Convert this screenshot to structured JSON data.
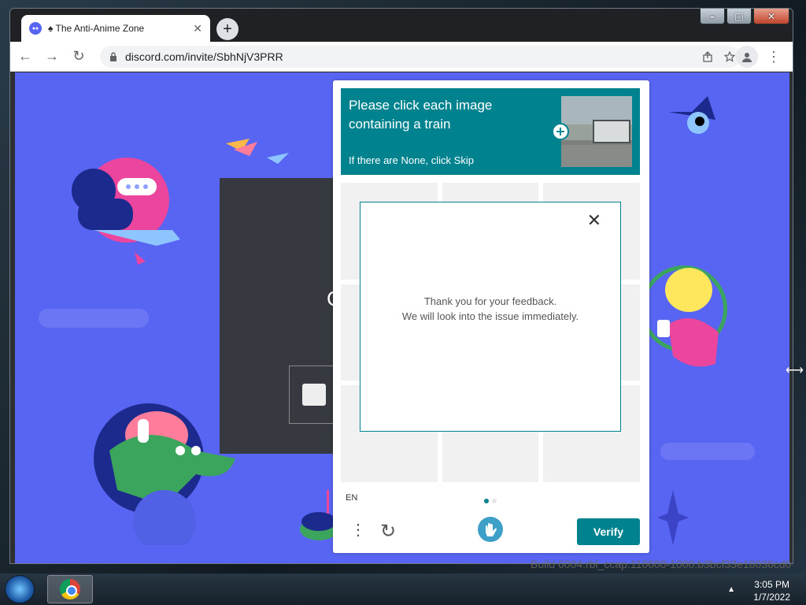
{
  "browser": {
    "tab": {
      "title": "♠ The Anti-Anime Zone",
      "close_symbol": "✕"
    },
    "new_tab_symbol": "+",
    "nav": {
      "back": "←",
      "forward": "→",
      "reload": "↻"
    },
    "address": {
      "url": "discord.com/invite/SbhNjV3PRR"
    },
    "menu_symbol": "⋮",
    "window_controls": {
      "minimize": "–",
      "maximize": "□",
      "close": "✕"
    }
  },
  "invite_card": {
    "partial_letter": "C"
  },
  "captcha": {
    "prompt_line1": "Please click each image",
    "prompt_line2": "containing a train",
    "skip_hint": "If there are None, click Skip",
    "expand_symbol": "+",
    "feedback": {
      "close_symbol": "✕",
      "line1": "Thank you for your feedback.",
      "line2": "We will look into the issue immediately."
    },
    "language": "EN",
    "more_symbol": "⋮",
    "refresh_symbol": "↻",
    "verify_label": "Verify",
    "accent_color": "#00838f"
  },
  "taskbar": {
    "time": "3:05 PM",
    "date": "1/7/2022",
    "tray_arrow": "▲"
  },
  "watermark": {
    "text": "Build 6004.rbl_ccap.110600-1000.b3bcf33e18036cd0"
  },
  "cursor_symbol": "⟷",
  "colors": {
    "page_bg": "#5865f2",
    "browser_frame": "#202124"
  }
}
